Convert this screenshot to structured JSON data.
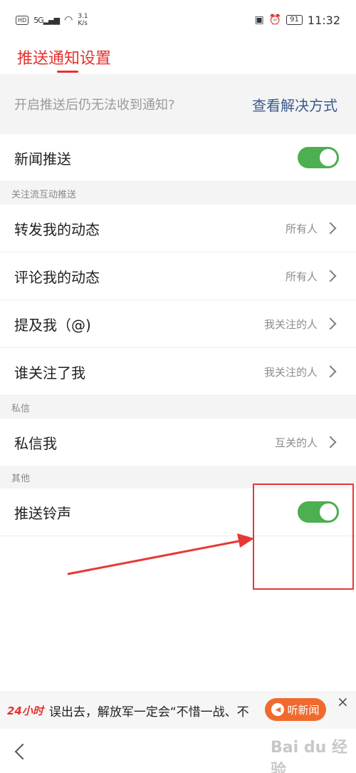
{
  "status_bar": {
    "hd": "HD",
    "signal": "5G",
    "speed_value": "3.1",
    "speed_unit": "K/s",
    "battery": "91",
    "time": "11:32"
  },
  "header": {
    "title": "推送通知设置"
  },
  "notice": {
    "text": "开启推送后仍无法收到通知?",
    "link": "查看解决方式"
  },
  "news_push": {
    "label": "新闻推送",
    "enabled": true
  },
  "sections": {
    "follow": "关注流互动推送",
    "private_msg": "私信",
    "other": "其他"
  },
  "follow_items": [
    {
      "label": "转发我的动态",
      "value": "所有人"
    },
    {
      "label": "评论我的动态",
      "value": "所有人"
    },
    {
      "label": "提及我（@)",
      "value": "我关注的人"
    },
    {
      "label": "谁关注了我",
      "value": "我关注的人"
    }
  ],
  "private_items": [
    {
      "label": "私信我",
      "value": "互关的人"
    }
  ],
  "push_ringtone": {
    "label": "推送铃声",
    "enabled": true
  },
  "news_bar": {
    "logo": "24小时",
    "text": "误出去，解放军一定会“不惜一战、不",
    "listen_label": "听新闻",
    "close": "×"
  },
  "watermark": "Bai du 经验",
  "colors": {
    "accent": "#e5322d",
    "toggle_on": "#4caf50",
    "link": "#3a5a8c",
    "annotation": "#e53935"
  }
}
